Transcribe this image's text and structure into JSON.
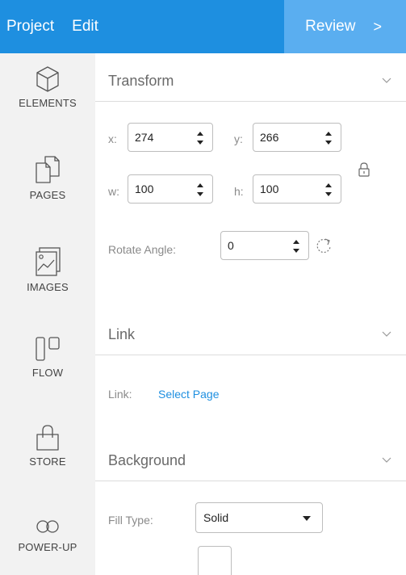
{
  "topbar": {
    "menu": [
      "Project",
      "Edit"
    ],
    "review_label": "Review",
    "review_chevron": ">"
  },
  "sidebar": {
    "items": [
      {
        "label": "ELEMENTS",
        "icon": "cube-icon"
      },
      {
        "label": "PAGES",
        "icon": "pages-icon"
      },
      {
        "label": "IMAGES",
        "icon": "images-icon"
      },
      {
        "label": "FLOW",
        "icon": "flow-icon"
      },
      {
        "label": "STORE",
        "icon": "shopping-bag-icon"
      },
      {
        "label": "POWER-UP",
        "icon": "infinity-icon"
      }
    ]
  },
  "transform": {
    "title": "Transform",
    "x_label": "x:",
    "x_value": "274",
    "y_label": "y:",
    "y_value": "266",
    "w_label": "w:",
    "w_value": "100",
    "h_label": "h:",
    "h_value": "100",
    "rotate_label": "Rotate Angle:",
    "rotate_value": "0"
  },
  "link": {
    "title": "Link",
    "label": "Link:",
    "value": "Select Page"
  },
  "background": {
    "title": "Background",
    "fill_label": "Fill Type:",
    "fill_value": "Solid",
    "swatch_color": "#ffffff"
  },
  "colors": {
    "topbar": "#1e8fe0",
    "review": "#5aaef0",
    "sidebar": "#f2f2f2",
    "link": "#1e8fe0"
  }
}
